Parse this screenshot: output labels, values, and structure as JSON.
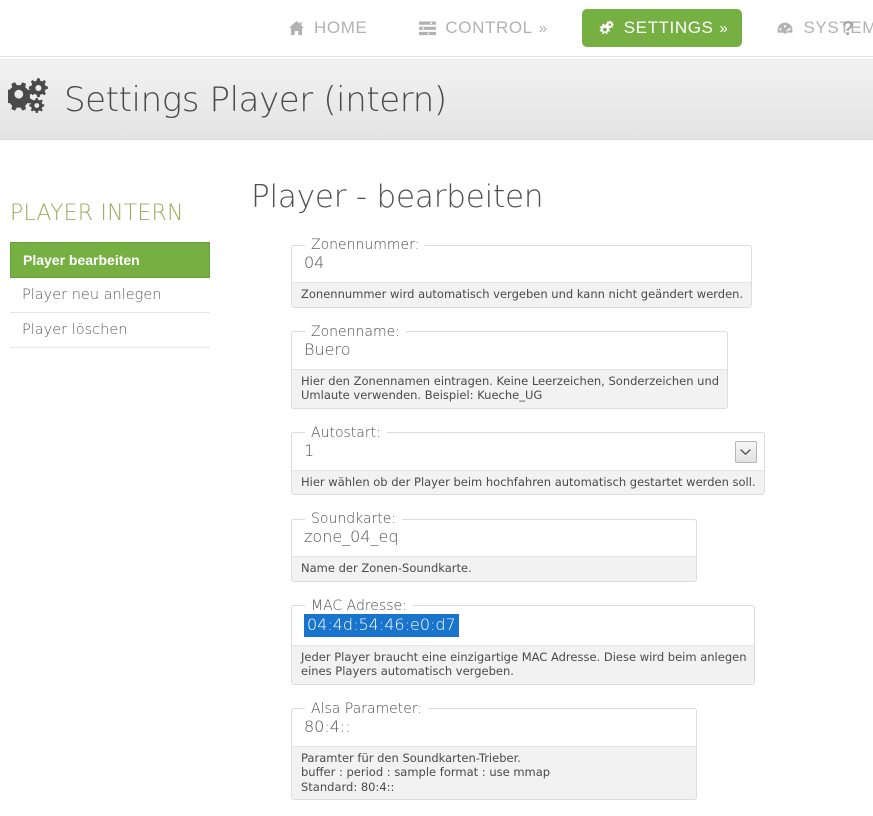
{
  "nav": {
    "items": [
      {
        "label": "HOME",
        "icon": "home-icon",
        "chevron": "",
        "active": false
      },
      {
        "label": "CONTROL",
        "icon": "sliders-icon",
        "chevron": "»",
        "active": false
      },
      {
        "label": "SETTINGS",
        "icon": "cogs-icon",
        "chevron": "»",
        "active": true
      },
      {
        "label": "SYSTEM",
        "icon": "dashboard-icon",
        "chevron": "»",
        "active": false
      }
    ],
    "help_label": "?",
    "active_color": "#76b043"
  },
  "page_header": {
    "icon": "cogs-icon",
    "title": "Settings Player (intern)"
  },
  "sidebar": {
    "title": "PLAYER INTERN",
    "title_color": "#9aab5c",
    "items": [
      {
        "label": "Player bearbeiten",
        "active": true
      },
      {
        "label": "Player neu anlegen",
        "active": false
      },
      {
        "label": "Player löschen",
        "active": false
      }
    ]
  },
  "main": {
    "title": "Player - bearbeiten",
    "fields": [
      {
        "legend": "Zonennummer:",
        "value": "04",
        "type": "text",
        "selected": false,
        "help": [
          "Zonennummer wird automatisch vergeben und kann nicht geändert werden."
        ]
      },
      {
        "legend": "Zonenname:",
        "value": "Buero",
        "type": "text",
        "selected": false,
        "help": [
          "Hier den Zonennamen eintragen. Keine Leerzeichen, Sonderzeichen und",
          "Umlaute verwenden. Beispiel: Kueche_UG"
        ]
      },
      {
        "legend": "Autostart:",
        "value": "1",
        "type": "select",
        "selected": false,
        "help": [
          "Hier wählen ob der Player beim hochfahren automatisch gestartet werden soll."
        ]
      },
      {
        "legend": "Soundkarte:",
        "value": "zone_04_eq",
        "type": "text",
        "selected": false,
        "help": [
          "Name der Zonen-Soundkarte."
        ]
      },
      {
        "legend": "MAC Adresse:",
        "value": "04:4d:54:46:e0:d7",
        "type": "text",
        "selected": true,
        "selection_color": "#1874cd",
        "help": [
          "Jeder Player braucht eine einzigartige MAC Adresse. Diese wird beim anlegen",
          "eines Players automatisch vergeben."
        ]
      },
      {
        "legend": "Alsa Parameter:",
        "value": "80:4::",
        "type": "text",
        "selected": false,
        "help": [
          "Paramter für den Soundkarten-Trieber.",
          "buffer : period : sample format : use mmap",
          "Standard: 80:4::"
        ]
      }
    ]
  }
}
